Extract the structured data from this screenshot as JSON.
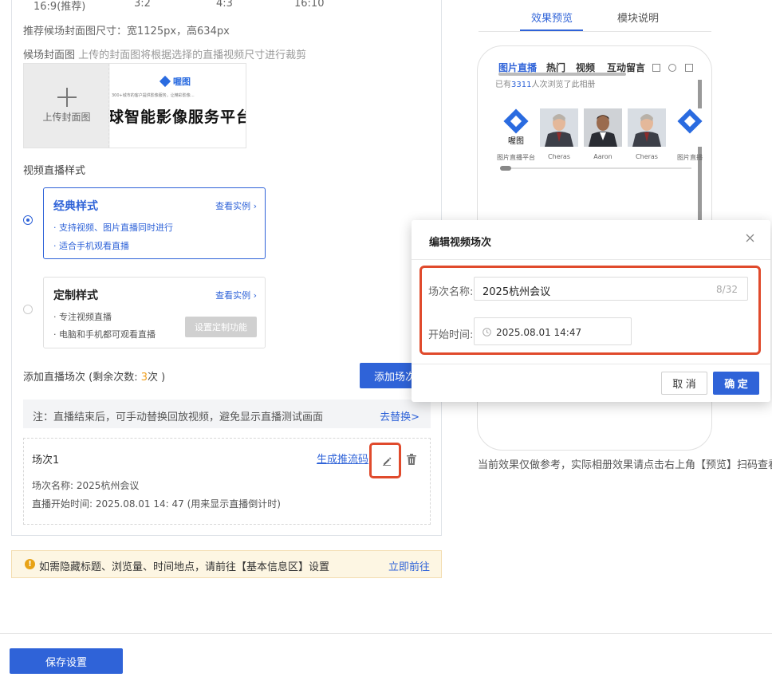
{
  "cover": {
    "ratios": [
      "16:9(推荐)",
      "3:2",
      "4:3",
      "16:10"
    ],
    "size_tip": "推荐候场封面图尺寸：宽1125px，高634px",
    "label": "候场封面图",
    "label_hint": "上传的封面图将根据选择的直播视频尺寸进行裁剪",
    "upload_text": "上传封面图",
    "banner_brand": "喔图",
    "banner_sub": "300+城市的客户提供影像服务，让精彩影像…",
    "banner_title": "球智能影像服务平台"
  },
  "style_section": {
    "title": "视频直播样式",
    "cards": [
      {
        "title": "经典样式",
        "link": "查看实例 ›",
        "features": [
          "· 支持视频、图片直播同时进行",
          "· 适合手机观看直播"
        ],
        "selected": true
      },
      {
        "title": "定制样式",
        "link": "查看实例 ›",
        "features": [
          "· 专注视频直播",
          "· 电脑和手机都可观看直播"
        ],
        "button": "设置定制功能",
        "selected": false
      }
    ]
  },
  "sessions": {
    "count_prefix": "添加直播场次 (剩余次数: ",
    "remaining": "3",
    "count_suffix": "次 )",
    "add_button": "添加场次",
    "note": "注：直播结束后，可手动替换回放视频，避免显示直播测试画面",
    "note_link": "去替换>",
    "items": [
      {
        "title": "场次1",
        "generate_link": "生成推流码",
        "name_line": "场次名称: 2025杭州会议",
        "time_line": "直播开始时间: 2025.08.01 14: 47  (用来显示直播倒计时)"
      }
    ]
  },
  "warning": {
    "icon": "!",
    "text": "如需隐藏标题、浏览量、时间地点，请前往【基本信息区】设置",
    "link": "立即前往"
  },
  "footer": {
    "save": "保存设置"
  },
  "preview": {
    "tabs": [
      "效果预览",
      "模块说明"
    ],
    "phone_tabs": [
      "图片直播",
      "热门",
      "视频",
      "互动留言"
    ],
    "viewers_prefix": "已有",
    "viewers": "3311",
    "viewers_suffix": "人次浏览了此相册",
    "photos": [
      {
        "caption": "图片直播平台",
        "kind": "logo"
      },
      {
        "caption": "Cheras",
        "kind": "person"
      },
      {
        "caption": "Aaron",
        "kind": "person"
      },
      {
        "caption": "Cheras",
        "kind": "person"
      },
      {
        "caption": "图片直播",
        "kind": "logo"
      }
    ],
    "note": "当前效果仅做参考，实际相册效果请点击右上角【预览】扫码查看"
  },
  "modal": {
    "title": "编辑视频场次",
    "name_label": "场次名称:",
    "name_value": "2025杭州会议",
    "name_count": "8/32",
    "time_label": "开始时间:",
    "time_value": "2025.08.01 14:47",
    "cancel": "取 消",
    "ok": "确 定"
  },
  "colors": {
    "accent": "#2f63d8",
    "highlight": "#e04a2c",
    "warning": "#e8a317",
    "remaining_count": "#f0a020"
  }
}
